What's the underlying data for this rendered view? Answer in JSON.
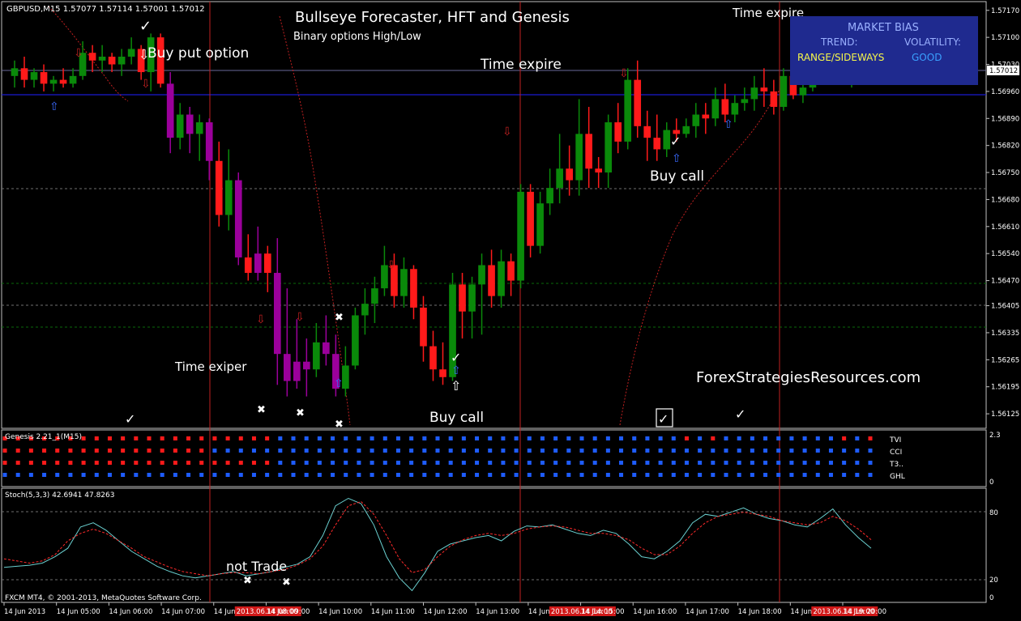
{
  "colors": {
    "background": "#000000",
    "bull": "#0a8a0a",
    "bear": "#ff1a1a",
    "bull_neutral": "#9b009b",
    "bear_neutral": "#9b009b",
    "grid": "#505050",
    "session_line": "#d02020",
    "blue_line": "#1a1ad0",
    "panel_border": "#c0c0c0",
    "genesis_blue": "#1e5cff",
    "genesis_red": "#ff1a1a",
    "stoch_main": "#6ad0d0",
    "stoch_signal": "#ff2a2a",
    "market_bias_bg": "#1f2a8f",
    "market_bias_range": "#f6f64a",
    "market_bias_good": "#3aa0ff"
  },
  "main_chart": {
    "symbol_header": "GBPUSD,M15  1.57077 1.57114 1.57001 1.57012",
    "title": "Bullseye Forecaster, HFT and Genesis",
    "subtitle": "Binary options High/Low",
    "watermark": "ForexStrategiesResources.com",
    "current_price_tag": "1.57012",
    "price_ticks": [
      "1.57170",
      "1.57100",
      "1.57030",
      "1.56960",
      "1.56890",
      "1.56820",
      "1.56750",
      "1.56680",
      "1.56610",
      "1.56540",
      "1.56470",
      "1.56405",
      "1.56335",
      "1.56265",
      "1.56195",
      "1.56125"
    ],
    "annotations": [
      {
        "name": "buy-put-option",
        "text": "Buy put option"
      },
      {
        "name": "time-expire-top",
        "text": "Time expire"
      },
      {
        "name": "time-expire-right",
        "text": "Time expire"
      },
      {
        "name": "time-exiper",
        "text": "Time exiper"
      },
      {
        "name": "buy-call-bottom",
        "text": "Buy call"
      },
      {
        "name": "buy-call-right",
        "text": "Buy call"
      }
    ]
  },
  "market_bias": {
    "title": "MARKET BIAS",
    "trend_label": "TREND:",
    "volatility_label": "VOLATILITY:",
    "trend_value": "RANGE/SIDEWAYS",
    "volatility_value": "GOOD"
  },
  "genesis_panel": {
    "title": "Genesis 2.21_1(M15)",
    "scale_top": "2.3",
    "scale_bottom": "0",
    "rows": [
      "TVI",
      "CCI",
      "T3..",
      "GHL"
    ]
  },
  "stoch_panel": {
    "title": "Stoch(5,3,3) 42.6941 47.8263",
    "annotation": "not Trade",
    "levels": [
      "80",
      "20",
      "0"
    ],
    "copyright": "FXCM MT4, © 2001-2013, MetaQuotes Software Corp."
  },
  "time_axis": {
    "labels": [
      "14 Jun 2013",
      "14 Jun 05:00",
      "14 Jun 06:00",
      "14 Jun 07:00",
      "14 Jun 08:00",
      "14 Jun 09:00",
      "14 Jun 10:00",
      "14 Jun 11:00",
      "14 Jun 12:00",
      "14 Jun 13:00",
      "14 Jun 14:00",
      "14 Jun 15:00",
      "14 Jun 16:00",
      "14 Jun 17:00",
      "14 Jun 18:00",
      "14 Jun 19:00",
      "14 Jun 20:00"
    ],
    "highlighted_labels": [
      "2013.06.14 08:00",
      "2013.06.14 14:00",
      "2013.06.14 19:00"
    ]
  },
  "chart_data": {
    "type": "candlestick",
    "title": "Bullseye Forecaster, HFT and Genesis",
    "subtitle": "Binary options High/Low",
    "symbol": "GBPUSD",
    "timeframe": "M15",
    "ylim": [
      1.561,
      1.5718
    ],
    "grid": false,
    "candles": [
      {
        "o": 1.57,
        "h": 1.5704,
        "l": 1.5697,
        "c": 1.5702,
        "dir": "up"
      },
      {
        "o": 1.5702,
        "h": 1.5705,
        "l": 1.5697,
        "c": 1.5699,
        "dir": "down"
      },
      {
        "o": 1.5699,
        "h": 1.5702,
        "l": 1.5697,
        "c": 1.5701,
        "dir": "up"
      },
      {
        "o": 1.5701,
        "h": 1.5703,
        "l": 1.5696,
        "c": 1.5698,
        "dir": "down"
      },
      {
        "o": 1.5698,
        "h": 1.57,
        "l": 1.5696,
        "c": 1.5699,
        "dir": "up"
      },
      {
        "o": 1.5699,
        "h": 1.5702,
        "l": 1.5697,
        "c": 1.5698,
        "dir": "down"
      },
      {
        "o": 1.5698,
        "h": 1.5702,
        "l": 1.5697,
        "c": 1.57,
        "dir": "up"
      },
      {
        "o": 1.57,
        "h": 1.5709,
        "l": 1.5699,
        "c": 1.5706,
        "dir": "up"
      },
      {
        "o": 1.5706,
        "h": 1.5708,
        "l": 1.5701,
        "c": 1.5704,
        "dir": "down"
      },
      {
        "o": 1.5704,
        "h": 1.5708,
        "l": 1.5701,
        "c": 1.5705,
        "dir": "up"
      },
      {
        "o": 1.5705,
        "h": 1.5706,
        "l": 1.5701,
        "c": 1.5703,
        "dir": "down"
      },
      {
        "o": 1.5703,
        "h": 1.5707,
        "l": 1.57,
        "c": 1.5705,
        "dir": "up"
      },
      {
        "o": 1.5705,
        "h": 1.571,
        "l": 1.5703,
        "c": 1.5707,
        "dir": "up"
      },
      {
        "o": 1.5707,
        "h": 1.5708,
        "l": 1.5699,
        "c": 1.5701,
        "dir": "down"
      },
      {
        "o": 1.5701,
        "h": 1.5711,
        "l": 1.5696,
        "c": 1.571,
        "dir": "up"
      },
      {
        "o": 1.571,
        "h": 1.5711,
        "l": 1.5697,
        "c": 1.5698,
        "dir": "down"
      },
      {
        "o": 1.5698,
        "h": 1.5701,
        "l": 1.568,
        "c": 1.5684,
        "dir": "down"
      },
      {
        "o": 1.5684,
        "h": 1.5693,
        "l": 1.5681,
        "c": 1.569,
        "dir": "up"
      },
      {
        "o": 1.569,
        "h": 1.5692,
        "l": 1.568,
        "c": 1.5685,
        "dir": "down"
      },
      {
        "o": 1.5685,
        "h": 1.569,
        "l": 1.5678,
        "c": 1.5688,
        "dir": "up"
      },
      {
        "o": 1.5688,
        "h": 1.5689,
        "l": 1.5673,
        "c": 1.5678,
        "dir": "down"
      },
      {
        "o": 1.5678,
        "h": 1.5683,
        "l": 1.5661,
        "c": 1.5664,
        "dir": "down"
      },
      {
        "o": 1.5664,
        "h": 1.5681,
        "l": 1.566,
        "c": 1.5673,
        "dir": "up"
      },
      {
        "o": 1.5673,
        "h": 1.5675,
        "l": 1.5651,
        "c": 1.5653,
        "dir": "down"
      },
      {
        "o": 1.5653,
        "h": 1.5659,
        "l": 1.5647,
        "c": 1.5649,
        "dir": "down"
      },
      {
        "o": 1.5649,
        "h": 1.5661,
        "l": 1.5647,
        "c": 1.5654,
        "dir": "up"
      },
      {
        "o": 1.5654,
        "h": 1.5656,
        "l": 1.5644,
        "c": 1.5649,
        "dir": "down"
      },
      {
        "o": 1.5649,
        "h": 1.5658,
        "l": 1.562,
        "c": 1.5628,
        "dir": "down"
      },
      {
        "o": 1.5628,
        "h": 1.5645,
        "l": 1.5617,
        "c": 1.5621,
        "dir": "down"
      },
      {
        "o": 1.5621,
        "h": 1.5637,
        "l": 1.5619,
        "c": 1.5626,
        "dir": "down"
      },
      {
        "o": 1.5626,
        "h": 1.5632,
        "l": 1.5617,
        "c": 1.5624,
        "dir": "down"
      },
      {
        "o": 1.5624,
        "h": 1.5636,
        "l": 1.5622,
        "c": 1.5631,
        "dir": "up"
      },
      {
        "o": 1.5631,
        "h": 1.5638,
        "l": 1.5625,
        "c": 1.5628,
        "dir": "down"
      },
      {
        "o": 1.5628,
        "h": 1.5633,
        "l": 1.5617,
        "c": 1.5619,
        "dir": "down"
      },
      {
        "o": 1.5619,
        "h": 1.563,
        "l": 1.5617,
        "c": 1.5625,
        "dir": "up"
      },
      {
        "o": 1.5625,
        "h": 1.564,
        "l": 1.5624,
        "c": 1.5638,
        "dir": "up"
      },
      {
        "o": 1.5638,
        "h": 1.5645,
        "l": 1.5633,
        "c": 1.5641,
        "dir": "up"
      },
      {
        "o": 1.5641,
        "h": 1.5648,
        "l": 1.5636,
        "c": 1.5645,
        "dir": "up"
      },
      {
        "o": 1.5645,
        "h": 1.5656,
        "l": 1.5643,
        "c": 1.5651,
        "dir": "up"
      },
      {
        "o": 1.5651,
        "h": 1.5654,
        "l": 1.564,
        "c": 1.5643,
        "dir": "down"
      },
      {
        "o": 1.5643,
        "h": 1.5653,
        "l": 1.564,
        "c": 1.565,
        "dir": "up"
      },
      {
        "o": 1.565,
        "h": 1.5651,
        "l": 1.5637,
        "c": 1.564,
        "dir": "down"
      },
      {
        "o": 1.564,
        "h": 1.5643,
        "l": 1.5626,
        "c": 1.563,
        "dir": "down"
      },
      {
        "o": 1.563,
        "h": 1.5634,
        "l": 1.5621,
        "c": 1.5624,
        "dir": "down"
      },
      {
        "o": 1.5624,
        "h": 1.5631,
        "l": 1.562,
        "c": 1.5622,
        "dir": "down"
      },
      {
        "o": 1.5622,
        "h": 1.5649,
        "l": 1.5621,
        "c": 1.5646,
        "dir": "up"
      },
      {
        "o": 1.5646,
        "h": 1.5649,
        "l": 1.5632,
        "c": 1.5639,
        "dir": "up"
      },
      {
        "o": 1.5639,
        "h": 1.5648,
        "l": 1.5632,
        "c": 1.5646,
        "dir": "down"
      },
      {
        "o": 1.5646,
        "h": 1.5654,
        "l": 1.5633,
        "c": 1.5651,
        "dir": "up"
      },
      {
        "o": 1.5651,
        "h": 1.5655,
        "l": 1.564,
        "c": 1.5643,
        "dir": "down"
      },
      {
        "o": 1.5643,
        "h": 1.5655,
        "l": 1.564,
        "c": 1.5652,
        "dir": "down"
      },
      {
        "o": 1.5652,
        "h": 1.5654,
        "l": 1.5643,
        "c": 1.5647,
        "dir": "down"
      },
      {
        "o": 1.5647,
        "h": 1.5672,
        "l": 1.5645,
        "c": 1.567,
        "dir": "up"
      },
      {
        "o": 1.567,
        "h": 1.5672,
        "l": 1.5653,
        "c": 1.5656,
        "dir": "down"
      },
      {
        "o": 1.5656,
        "h": 1.567,
        "l": 1.5654,
        "c": 1.5667,
        "dir": "up"
      },
      {
        "o": 1.5667,
        "h": 1.5676,
        "l": 1.5664,
        "c": 1.5671,
        "dir": "up"
      },
      {
        "o": 1.5671,
        "h": 1.5685,
        "l": 1.5667,
        "c": 1.5676,
        "dir": "up"
      },
      {
        "o": 1.5676,
        "h": 1.5682,
        "l": 1.5669,
        "c": 1.5673,
        "dir": "down"
      },
      {
        "o": 1.5673,
        "h": 1.5694,
        "l": 1.5669,
        "c": 1.5685,
        "dir": "up"
      },
      {
        "o": 1.5685,
        "h": 1.5692,
        "l": 1.5671,
        "c": 1.5676,
        "dir": "up"
      },
      {
        "o": 1.5676,
        "h": 1.5679,
        "l": 1.5671,
        "c": 1.5675,
        "dir": "down"
      },
      {
        "o": 1.5675,
        "h": 1.569,
        "l": 1.5671,
        "c": 1.5688,
        "dir": "up"
      },
      {
        "o": 1.5688,
        "h": 1.5693,
        "l": 1.568,
        "c": 1.5683,
        "dir": "up"
      },
      {
        "o": 1.5683,
        "h": 1.5702,
        "l": 1.5681,
        "c": 1.5699,
        "dir": "up"
      },
      {
        "o": 1.5699,
        "h": 1.5704,
        "l": 1.5684,
        "c": 1.5687,
        "dir": "down"
      },
      {
        "o": 1.5687,
        "h": 1.5691,
        "l": 1.5678,
        "c": 1.5684,
        "dir": "down"
      },
      {
        "o": 1.5684,
        "h": 1.569,
        "l": 1.5678,
        "c": 1.5681,
        "dir": "down"
      },
      {
        "o": 1.5681,
        "h": 1.5688,
        "l": 1.5679,
        "c": 1.5686,
        "dir": "up"
      },
      {
        "o": 1.5686,
        "h": 1.5689,
        "l": 1.5683,
        "c": 1.5685,
        "dir": "up"
      },
      {
        "o": 1.5685,
        "h": 1.5689,
        "l": 1.5684,
        "c": 1.5687,
        "dir": "up"
      },
      {
        "o": 1.5687,
        "h": 1.5693,
        "l": 1.5684,
        "c": 1.569,
        "dir": "up"
      },
      {
        "o": 1.569,
        "h": 1.5693,
        "l": 1.5685,
        "c": 1.5689,
        "dir": "up"
      },
      {
        "o": 1.5689,
        "h": 1.5697,
        "l": 1.5687,
        "c": 1.5694,
        "dir": "up"
      },
      {
        "o": 1.5694,
        "h": 1.5698,
        "l": 1.5688,
        "c": 1.569,
        "dir": "up"
      },
      {
        "o": 1.569,
        "h": 1.5695,
        "l": 1.5688,
        "c": 1.5693,
        "dir": "up"
      },
      {
        "o": 1.5693,
        "h": 1.5697,
        "l": 1.5691,
        "c": 1.5694,
        "dir": "down"
      },
      {
        "o": 1.5694,
        "h": 1.57,
        "l": 1.5691,
        "c": 1.5697,
        "dir": "up"
      },
      {
        "o": 1.5697,
        "h": 1.5702,
        "l": 1.5692,
        "c": 1.5696,
        "dir": "up"
      },
      {
        "o": 1.5696,
        "h": 1.5699,
        "l": 1.569,
        "c": 1.5692,
        "dir": "down"
      },
      {
        "o": 1.5692,
        "h": 1.5702,
        "l": 1.5691,
        "c": 1.57,
        "dir": "up"
      },
      {
        "o": 1.57,
        "h": 1.5702,
        "l": 1.5694,
        "c": 1.5695,
        "dir": "down"
      },
      {
        "o": 1.5695,
        "h": 1.5699,
        "l": 1.5693,
        "c": 1.5697,
        "dir": "up"
      },
      {
        "o": 1.5697,
        "h": 1.5703,
        "l": 1.5696,
        "c": 1.5702,
        "dir": "up"
      },
      {
        "o": 1.5702,
        "h": 1.5705,
        "l": 1.57,
        "c": 1.5704,
        "dir": "up"
      },
      {
        "o": 1.5704,
        "h": 1.5708,
        "l": 1.5701,
        "c": 1.5705,
        "dir": "up"
      },
      {
        "o": 1.5705,
        "h": 1.5706,
        "l": 1.5699,
        "c": 1.5701,
        "dir": "down"
      },
      {
        "o": 1.5701,
        "h": 1.5703,
        "l": 1.5697,
        "c": 1.5702,
        "dir": "up"
      },
      {
        "o": 1.5702,
        "h": 1.571,
        "l": 1.5701,
        "c": 1.5708,
        "dir": "up"
      },
      {
        "o": 1.5708,
        "h": 1.5711,
        "l": 1.57,
        "c": 1.5701,
        "dir": "down"
      }
    ],
    "indicator_stoch": {
      "main": [
        30,
        31,
        32,
        34,
        40,
        48,
        68,
        72,
        65,
        55,
        45,
        38,
        31,
        26,
        22,
        20,
        22,
        24,
        26,
        22,
        24,
        26,
        30,
        33,
        40,
        60,
        88,
        95,
        90,
        70,
        40,
        20,
        8,
        25,
        45,
        52,
        55,
        58,
        60,
        55,
        64,
        69,
        68,
        70,
        66,
        62,
        60,
        65,
        62,
        52,
        40,
        38,
        45,
        55,
        72,
        80,
        78,
        82,
        86,
        80,
        76,
        74,
        70,
        68,
        76,
        85,
        70,
        58,
        48
      ],
      "signal": [
        38,
        36,
        34,
        36,
        42,
        55,
        62,
        66,
        62,
        55,
        48,
        40,
        35,
        30,
        26,
        24,
        22,
        24,
        25,
        25,
        24,
        26,
        28,
        32,
        38,
        50,
        70,
        88,
        92,
        80,
        60,
        38,
        25,
        28,
        40,
        50,
        56,
        60,
        62,
        60,
        62,
        66,
        68,
        69,
        68,
        65,
        62,
        62,
        60,
        56,
        48,
        42,
        42,
        50,
        62,
        72,
        78,
        80,
        82,
        80,
        78,
        74,
        72,
        70,
        72,
        78,
        74,
        66,
        56
      ]
    }
  }
}
